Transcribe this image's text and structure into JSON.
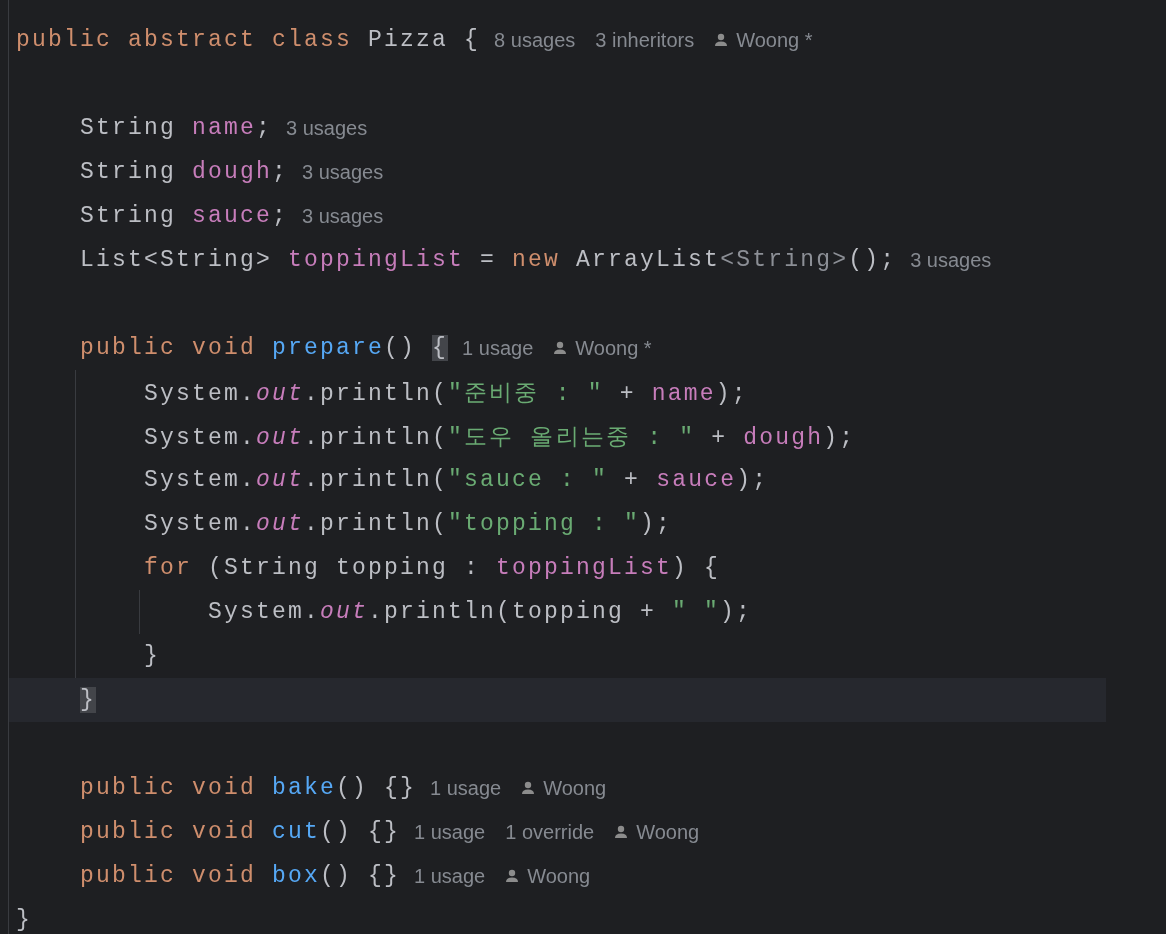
{
  "editor": {
    "lines": [
      {
        "current": false,
        "tokens": [
          {
            "kind": "keyword",
            "text": "public abstract class "
          },
          {
            "kind": "plain",
            "text": "Pizza {"
          }
        ],
        "hints": [
          {
            "kind": "usage",
            "text": "8 usages"
          },
          {
            "kind": "usage",
            "text": "3 inheritors"
          },
          {
            "kind": "author",
            "text": "Woong *"
          }
        ],
        "children": [
          {
            "current": false
          },
          {
            "current": false,
            "tokens": [
              {
                "kind": "plain",
                "text": "String "
              },
              {
                "kind": "field",
                "text": "name"
              },
              {
                "kind": "plain",
                "text": ";"
              }
            ],
            "hints": [
              {
                "kind": "usage",
                "text": "3 usages"
              }
            ]
          },
          {
            "current": false,
            "tokens": [
              {
                "kind": "plain",
                "text": "String "
              },
              {
                "kind": "field",
                "text": "dough"
              },
              {
                "kind": "plain",
                "text": ";"
              }
            ],
            "hints": [
              {
                "kind": "usage",
                "text": "3 usages"
              }
            ]
          },
          {
            "current": false,
            "tokens": [
              {
                "kind": "plain",
                "text": "String "
              },
              {
                "kind": "field",
                "text": "sauce"
              },
              {
                "kind": "plain",
                "text": ";"
              }
            ],
            "hints": [
              {
                "kind": "usage",
                "text": "3 usages"
              }
            ]
          },
          {
            "current": false,
            "tokens": [
              {
                "kind": "plain",
                "text": "List<String> "
              },
              {
                "kind": "field",
                "text": "toppingList"
              },
              {
                "kind": "plain",
                "text": " = "
              },
              {
                "kind": "keyword",
                "text": "new "
              },
              {
                "kind": "plain",
                "text": "ArrayList"
              },
              {
                "kind": "generic",
                "text": "<String>"
              },
              {
                "kind": "plain",
                "text": "();"
              }
            ],
            "hints": [
              {
                "kind": "usage",
                "text": "3 usages"
              }
            ]
          },
          {
            "current": false
          },
          {
            "current": false,
            "tokens": [
              {
                "kind": "keyword",
                "text": "public void "
              },
              {
                "kind": "method",
                "text": "prepare"
              },
              {
                "kind": "plain",
                "text": "() "
              },
              {
                "kind": "matched-brace",
                "text": "{"
              }
            ],
            "hints": [
              {
                "kind": "usage",
                "text": "1 usage"
              },
              {
                "kind": "author",
                "text": "Woong *"
              }
            ],
            "children": [
              {
                "current": false,
                "tokens": [
                  {
                    "kind": "plain",
                    "text": "System."
                  },
                  {
                    "kind": "static",
                    "text": "out"
                  },
                  {
                    "kind": "plain",
                    "text": ".println("
                  },
                  {
                    "kind": "string",
                    "text": "\"준비중 : \""
                  },
                  {
                    "kind": "plain",
                    "text": " + "
                  },
                  {
                    "kind": "field",
                    "text": "name"
                  },
                  {
                    "kind": "plain",
                    "text": ");"
                  }
                ]
              },
              {
                "current": false,
                "tokens": [
                  {
                    "kind": "plain",
                    "text": "System."
                  },
                  {
                    "kind": "static",
                    "text": "out"
                  },
                  {
                    "kind": "plain",
                    "text": ".println("
                  },
                  {
                    "kind": "string",
                    "text": "\"도우 올리는중 : \""
                  },
                  {
                    "kind": "plain",
                    "text": " + "
                  },
                  {
                    "kind": "field",
                    "text": "dough"
                  },
                  {
                    "kind": "plain",
                    "text": ");"
                  }
                ]
              },
              {
                "current": false,
                "tokens": [
                  {
                    "kind": "plain",
                    "text": "System."
                  },
                  {
                    "kind": "static",
                    "text": "out"
                  },
                  {
                    "kind": "plain",
                    "text": ".println("
                  },
                  {
                    "kind": "string",
                    "text": "\"sauce : \""
                  },
                  {
                    "kind": "plain",
                    "text": " + "
                  },
                  {
                    "kind": "field",
                    "text": "sauce"
                  },
                  {
                    "kind": "plain",
                    "text": ");"
                  }
                ]
              },
              {
                "current": false,
                "tokens": [
                  {
                    "kind": "plain",
                    "text": "System."
                  },
                  {
                    "kind": "static",
                    "text": "out"
                  },
                  {
                    "kind": "plain",
                    "text": ".println("
                  },
                  {
                    "kind": "string",
                    "text": "\"topping : \""
                  },
                  {
                    "kind": "plain",
                    "text": ");"
                  }
                ]
              },
              {
                "current": false,
                "tokens": [
                  {
                    "kind": "keyword",
                    "text": "for "
                  },
                  {
                    "kind": "plain",
                    "text": "(String topping : "
                  },
                  {
                    "kind": "field",
                    "text": "toppingList"
                  },
                  {
                    "kind": "plain",
                    "text": ") {"
                  }
                ],
                "children": [
                  {
                    "current": false,
                    "tokens": [
                      {
                        "kind": "plain",
                        "text": "System."
                      },
                      {
                        "kind": "static",
                        "text": "out"
                      },
                      {
                        "kind": "plain",
                        "text": ".println(topping + "
                      },
                      {
                        "kind": "string",
                        "text": "\" \""
                      },
                      {
                        "kind": "plain",
                        "text": ");"
                      }
                    ]
                  }
                ]
              },
              {
                "current": false,
                "tokens": [
                  {
                    "kind": "plain",
                    "text": "}"
                  }
                ]
              }
            ]
          },
          {
            "current": true,
            "tokens": [
              {
                "kind": "matched-brace",
                "text": "}"
              }
            ]
          },
          {
            "current": false
          },
          {
            "current": false,
            "tokens": [
              {
                "kind": "keyword",
                "text": "public void "
              },
              {
                "kind": "method",
                "text": "bake"
              },
              {
                "kind": "plain",
                "text": "() {}"
              }
            ],
            "hints": [
              {
                "kind": "usage",
                "text": "1 usage"
              },
              {
                "kind": "author",
                "text": "Woong"
              }
            ]
          },
          {
            "current": false,
            "tokens": [
              {
                "kind": "keyword",
                "text": "public void "
              },
              {
                "kind": "method",
                "text": "cut"
              },
              {
                "kind": "plain",
                "text": "() {}"
              }
            ],
            "hints": [
              {
                "kind": "usage",
                "text": "1 usage"
              },
              {
                "kind": "usage",
                "text": "1 override"
              },
              {
                "kind": "author",
                "text": "Woong"
              }
            ]
          },
          {
            "current": false,
            "tokens": [
              {
                "kind": "keyword",
                "text": "public void "
              },
              {
                "kind": "method",
                "text": "box"
              },
              {
                "kind": "plain",
                "text": "() {}"
              }
            ],
            "hints": [
              {
                "kind": "usage",
                "text": "1 usage"
              },
              {
                "kind": "author",
                "text": "Woong"
              }
            ]
          }
        ]
      },
      {
        "current": false,
        "tokens": [
          {
            "kind": "plain",
            "text": "}"
          }
        ]
      }
    ]
  }
}
